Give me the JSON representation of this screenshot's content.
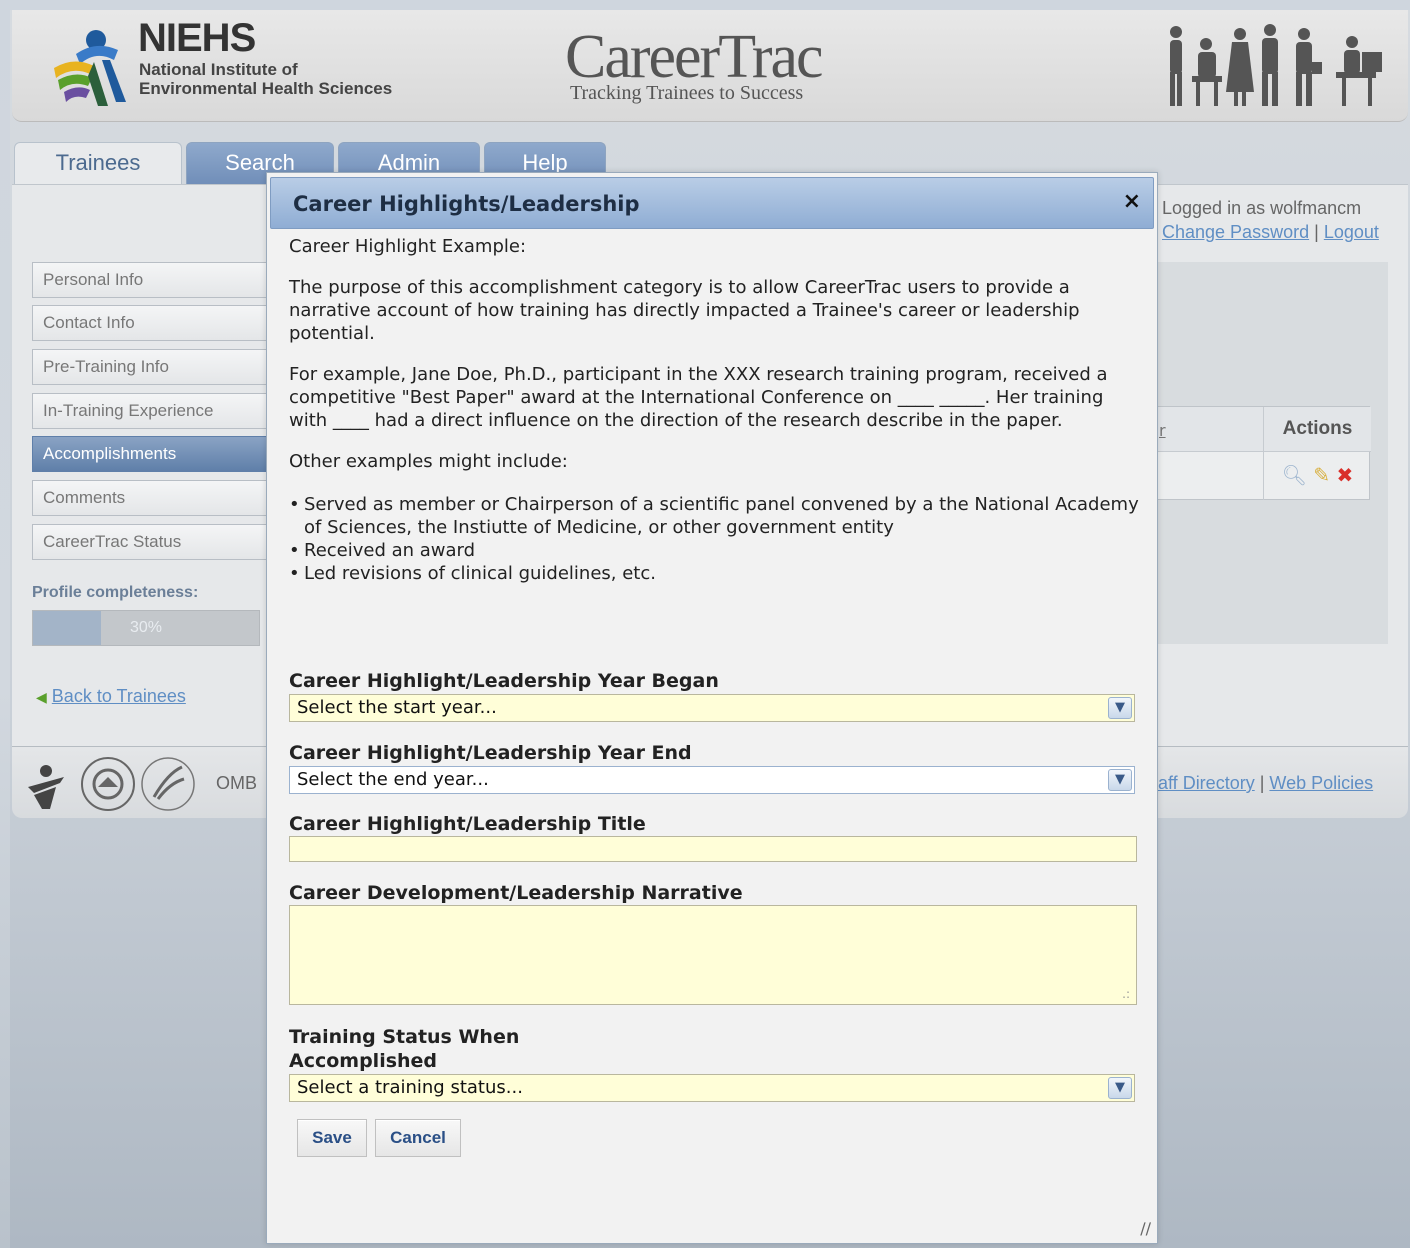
{
  "header": {
    "org_name": "NIEHS",
    "org_sub_line1": "National Institute of",
    "org_sub_line2": "Environmental Health Sciences",
    "app_title": "CareerTrac",
    "app_tagline": "Tracking Trainees to Success"
  },
  "tabs": [
    {
      "label": "Trainees",
      "active": true
    },
    {
      "label": "Search",
      "active": false
    },
    {
      "label": "Admin",
      "active": false
    },
    {
      "label": "Help",
      "active": false
    }
  ],
  "sidebar": {
    "items": [
      {
        "label": "Personal Info"
      },
      {
        "label": "Contact Info"
      },
      {
        "label": "Pre-Training Info"
      },
      {
        "label": "In-Training Experience"
      },
      {
        "label": "Accomplishments",
        "active": true
      },
      {
        "label": "Comments"
      },
      {
        "label": "CareerTrac Status"
      }
    ],
    "profile_label": "Profile completeness:",
    "profile_value": "30%",
    "profile_fraction": 0.3,
    "back_link": "Back to Trainees"
  },
  "user": {
    "logged_in_text": "Logged in as wolfmancm",
    "change_password": "Change Password",
    "separator": "|",
    "logout": "Logout"
  },
  "table": {
    "left_header_fragment": "r",
    "actions_header": "Actions"
  },
  "footer": {
    "omb": "OMB",
    "staff_directory": "aff Directory",
    "separator": "|",
    "web_policies": "Web Policies"
  },
  "modal": {
    "title": "Career Highlights/Leadership",
    "close_symbol": "×",
    "intro": "Career Highlight Example:",
    "para1": "The purpose of this accomplishment category is to allow CareerTrac users to provide a narrative account of how training has directly impacted a Trainee's career or leadership potential.",
    "para2": "For example, Jane Doe, Ph.D., participant in the XXX research training program, received a competitive \"Best Paper\" award at the International Conference on ____ _____. Her training with ____ had a direct influence on the direction of the research describe in the paper.",
    "para3": "Other examples might include:",
    "bullets": [
      "Served as member or Chairperson of a scientific panel convened by a the National Academy of Sciences, the Instiutte of Medicine, or other government entity",
      "Received an award",
      "Led revisions of clinical guidelines, etc."
    ],
    "fields": {
      "year_began_label": "Career Highlight/Leadership Year Began",
      "year_began_placeholder": "Select the start year...",
      "year_end_label": "Career Highlight/Leadership Year End",
      "year_end_placeholder": "Select the end year...",
      "title_label": "Career Highlight/Leadership Title",
      "title_value": "",
      "narrative_label": "Career Development/Leadership Narrative",
      "narrative_value": "",
      "status_label_line1": "Training Status When",
      "status_label_line2": "Accomplished",
      "status_placeholder": "Select a training status..."
    },
    "save_label": "Save",
    "cancel_label": "Cancel"
  },
  "colors": {
    "accent_blue": "#6f8db8",
    "field_yellow": "#fffed8",
    "link_blue": "#5f8ec4",
    "delete_red": "#d9302a"
  },
  "icons": [
    "niehs-logo-icon",
    "people-silhouette-icon",
    "magnifier-icon",
    "pencil-icon",
    "delete-x-icon",
    "back-arrow-icon",
    "hhs-logo-icon",
    "nih-seal-icon",
    "dropdown-arrow-icon",
    "resize-grip-icon"
  ]
}
